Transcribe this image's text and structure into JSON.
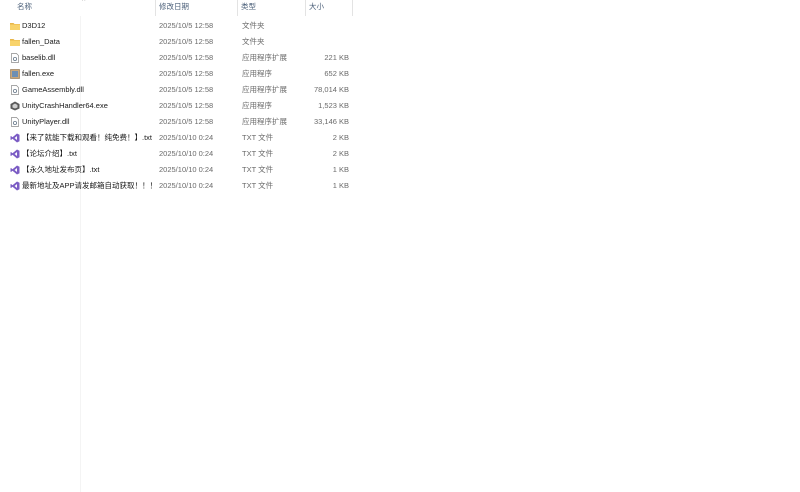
{
  "columns": {
    "name": "名称",
    "date": "修改日期",
    "type": "类型",
    "size": "大小"
  },
  "files": [
    {
      "name": "D3D12",
      "date": "2025/10/5 12:58",
      "type": "文件夹",
      "size": "",
      "icon": "folder-icon"
    },
    {
      "name": "fallen_Data",
      "date": "2025/10/5 12:58",
      "type": "文件夹",
      "size": "",
      "icon": "folder-icon"
    },
    {
      "name": "baselib.dll",
      "date": "2025/10/5 12:58",
      "type": "应用程序扩展",
      "size": "221 KB",
      "icon": "dll-icon"
    },
    {
      "name": "fallen.exe",
      "date": "2025/10/5 12:58",
      "type": "应用程序",
      "size": "652 KB",
      "icon": "app-icon"
    },
    {
      "name": "GameAssembly.dll",
      "date": "2025/10/5 12:58",
      "type": "应用程序扩展",
      "size": "78,014 KB",
      "icon": "dll-icon"
    },
    {
      "name": "UnityCrashHandler64.exe",
      "date": "2025/10/5 12:58",
      "type": "应用程序",
      "size": "1,523 KB",
      "icon": "unity-icon"
    },
    {
      "name": "UnityPlayer.dll",
      "date": "2025/10/5 12:58",
      "type": "应用程序扩展",
      "size": "33,146 KB",
      "icon": "dll-icon"
    },
    {
      "name": "【来了就能下载和观看！纯免费！】.txt",
      "date": "2025/10/10 0:24",
      "type": "TXT 文件",
      "size": "2 KB",
      "icon": "visual-studio-icon"
    },
    {
      "name": "【论坛介绍】.txt",
      "date": "2025/10/10 0:24",
      "type": "TXT 文件",
      "size": "2 KB",
      "icon": "visual-studio-icon"
    },
    {
      "name": "【永久地址发布页】.txt",
      "date": "2025/10/10 0:24",
      "type": "TXT 文件",
      "size": "1 KB",
      "icon": "visual-studio-icon"
    },
    {
      "name": "最新地址及APP请发邮箱自动获取！！！...",
      "date": "2025/10/10 0:24",
      "type": "TXT 文件",
      "size": "1 KB",
      "icon": "visual-studio-icon"
    }
  ]
}
